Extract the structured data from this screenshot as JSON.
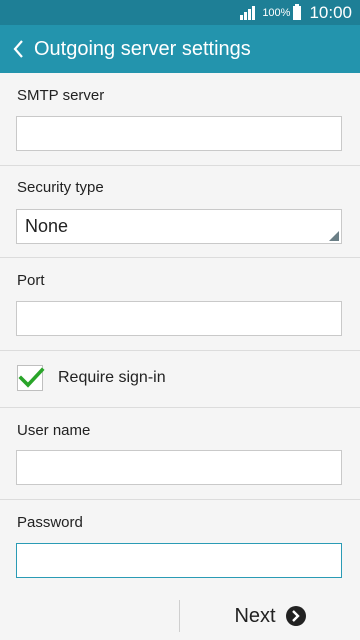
{
  "status_bar": {
    "battery_percent": "100%",
    "time": "10:00",
    "signal_icon": "signal-icon",
    "battery_icon": "battery-icon"
  },
  "header": {
    "title": "Outgoing server settings",
    "back_icon": "chevron-left-icon"
  },
  "form": {
    "smtp_server": {
      "label": "SMTP server",
      "value": "",
      "placeholder": ""
    },
    "security_type": {
      "label": "Security type",
      "value": "None"
    },
    "port": {
      "label": "Port",
      "value": "",
      "placeholder": ""
    },
    "require_signin": {
      "label": "Require sign-in",
      "checked": true
    },
    "user_name": {
      "label": "User name",
      "value": "",
      "placeholder": ""
    },
    "password": {
      "label": "Password",
      "value": "",
      "placeholder": ""
    }
  },
  "footer": {
    "next_label": "Next",
    "next_icon": "chevron-right-circle-icon"
  },
  "colors": {
    "status_bar": "#1e7f96",
    "app_bar": "#2394ad",
    "check": "#2aa52a",
    "focus_border": "#2a9bb5"
  }
}
